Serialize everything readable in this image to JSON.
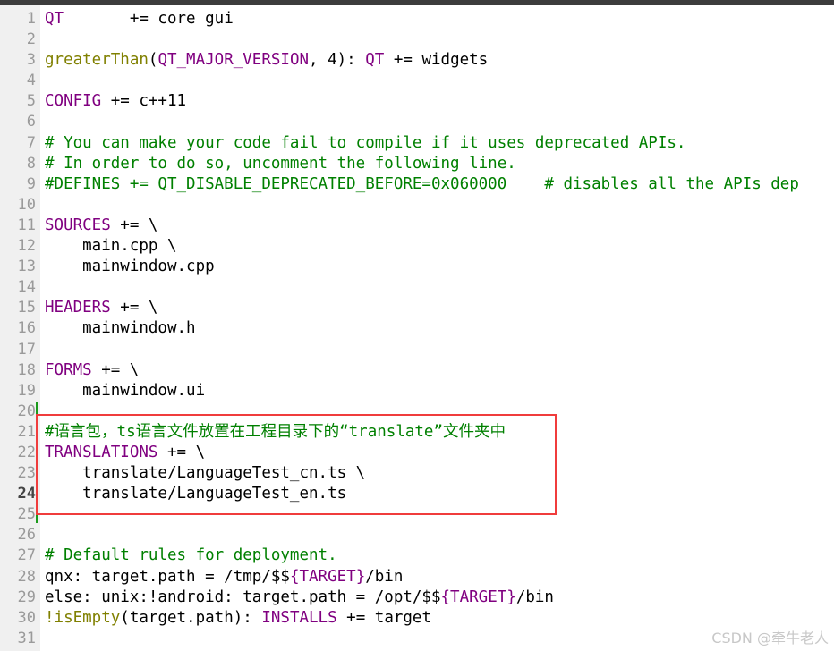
{
  "colors": {
    "keyword": "#800080",
    "function": "#808000",
    "comment": "#008000",
    "text": "#000000",
    "highlight_box": "#f03c3c",
    "modified_marker": "#1a9a1a"
  },
  "current_line": 24,
  "lines": [
    [
      {
        "t": "QT",
        "c": "kw"
      },
      {
        "t": "       += core gui",
        "c": "tx"
      }
    ],
    [],
    [
      {
        "t": "greaterThan",
        "c": "fn"
      },
      {
        "t": "(",
        "c": "tx"
      },
      {
        "t": "QT_MAJOR_VERSION",
        "c": "kw"
      },
      {
        "t": ", 4): ",
        "c": "tx"
      },
      {
        "t": "QT",
        "c": "kw"
      },
      {
        "t": " += widgets",
        "c": "tx"
      }
    ],
    [],
    [
      {
        "t": "CONFIG",
        "c": "kw"
      },
      {
        "t": " += c++11",
        "c": "tx"
      }
    ],
    [],
    [
      {
        "t": "# You can make your code fail to compile if it uses deprecated APIs.",
        "c": "cm"
      }
    ],
    [
      {
        "t": "# In order to do so, uncomment the following line.",
        "c": "cm"
      }
    ],
    [
      {
        "t": "#DEFINES += QT_DISABLE_DEPRECATED_BEFORE=0x060000    # disables all the APIs dep",
        "c": "cm"
      }
    ],
    [],
    [
      {
        "t": "SOURCES",
        "c": "kw"
      },
      {
        "t": " += \\",
        "c": "tx"
      }
    ],
    [
      {
        "t": "    main.cpp \\",
        "c": "tx"
      }
    ],
    [
      {
        "t": "    mainwindow.cpp",
        "c": "tx"
      }
    ],
    [],
    [
      {
        "t": "HEADERS",
        "c": "kw"
      },
      {
        "t": " += \\",
        "c": "tx"
      }
    ],
    [
      {
        "t": "    mainwindow.h",
        "c": "tx"
      }
    ],
    [],
    [
      {
        "t": "FORMS",
        "c": "kw"
      },
      {
        "t": " += \\",
        "c": "tx"
      }
    ],
    [
      {
        "t": "    mainwindow.ui",
        "c": "tx"
      }
    ],
    [],
    [
      {
        "t": "#语言包，ts语言文件放置在工程目录下的“translate”文件夹中",
        "c": "cm"
      }
    ],
    [
      {
        "t": "TRANSLATIONS",
        "c": "kw"
      },
      {
        "t": " += \\",
        "c": "tx"
      }
    ],
    [
      {
        "t": "    translate/LanguageTest_cn.ts \\",
        "c": "tx"
      }
    ],
    [
      {
        "t": "    translate/LanguageTest_en.ts",
        "c": "tx"
      }
    ],
    [],
    [],
    [
      {
        "t": "# Default rules for deployment.",
        "c": "cm"
      }
    ],
    [
      {
        "t": "qnx: target.path = /tmp/$$",
        "c": "tx"
      },
      {
        "t": "{TARGET}",
        "c": "kw"
      },
      {
        "t": "/bin",
        "c": "tx"
      }
    ],
    [
      {
        "t": "else: unix:!android: target.path = /opt/$$",
        "c": "tx"
      },
      {
        "t": "{TARGET}",
        "c": "kw"
      },
      {
        "t": "/bin",
        "c": "tx"
      }
    ],
    [
      {
        "t": "!isEmpty",
        "c": "fn"
      },
      {
        "t": "(target.path): ",
        "c": "tx"
      },
      {
        "t": "INSTALLS",
        "c": "kw"
      },
      {
        "t": " += target",
        "c": "tx"
      }
    ],
    []
  ],
  "line_numbers": [
    "1",
    "2",
    "3",
    "4",
    "5",
    "6",
    "7",
    "8",
    "9",
    "10",
    "11",
    "12",
    "13",
    "14",
    "15",
    "16",
    "17",
    "18",
    "19",
    "20",
    "21",
    "22",
    "23",
    "24",
    "25",
    "26",
    "27",
    "28",
    "29",
    "30",
    "31"
  ],
  "watermark": "CSDN @牵牛老人"
}
